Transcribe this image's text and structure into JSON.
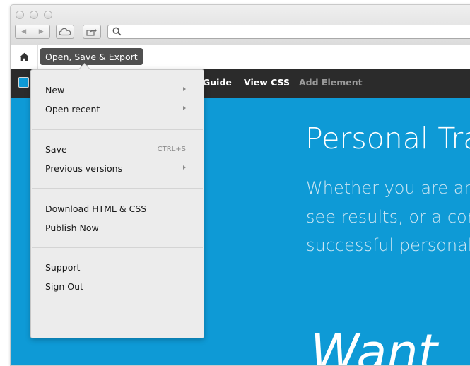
{
  "editor": {
    "tooltip": "Open, Save & Export"
  },
  "nav": {
    "guide": "Guide",
    "view_css": "View CSS",
    "add_element": "Add Element"
  },
  "menu": {
    "groups": [
      [
        {
          "label": "New",
          "submenu": true
        },
        {
          "label": "Open recent",
          "submenu": true
        }
      ],
      [
        {
          "label": "Save",
          "shortcut": "CTRL+S"
        },
        {
          "label": "Previous versions",
          "submenu": true
        }
      ],
      [
        {
          "label": "Download HTML & CSS"
        },
        {
          "label": "Publish Now"
        }
      ],
      [
        {
          "label": "Support"
        },
        {
          "label": "Sign Out"
        }
      ]
    ]
  },
  "page": {
    "title": "Personal Tra",
    "line1": "Whether you are an",
    "line2": "see results, or a com",
    "line3": "successful personal",
    "big_word": "Want"
  },
  "colors": {
    "accent": "#0e9ad6",
    "nav_bg": "#2b2b2b",
    "tooltip_bg": "#505050"
  }
}
